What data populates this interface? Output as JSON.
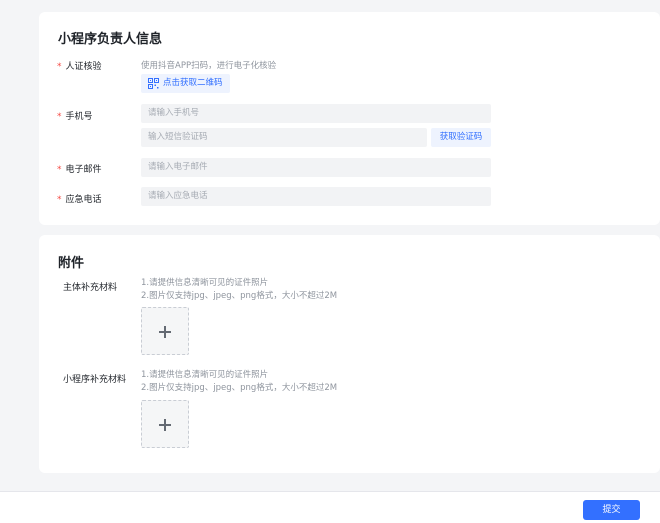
{
  "responsible_section": {
    "title": "小程序负责人信息",
    "id_verify": {
      "label": "人证核验",
      "hint": "使用抖音APP扫码，进行电子化核验",
      "qr_button": "点击获取二维码"
    },
    "phone": {
      "label": "手机号",
      "phone_placeholder": "请输入手机号",
      "sms_placeholder": "输入短信验证码",
      "get_code_button": "获取验证码"
    },
    "email": {
      "label": "电子邮件",
      "placeholder": "请输入电子邮件"
    },
    "emergency": {
      "label": "应急电话",
      "placeholder": "请输入应急电话"
    }
  },
  "attachment_section": {
    "title": "附件",
    "subject_material": {
      "label": "主体补充材料",
      "hint_line1": "1.请提供信息清晰可见的证件照片",
      "hint_line2": "2.图片仅支持jpg、jpeg、png格式，大小不超过2M"
    },
    "app_material": {
      "label": "小程序补充材料",
      "hint_line1": "1.请提供信息清晰可见的证件照片",
      "hint_line2": "2.图片仅支持jpg、jpeg、png格式，大小不超过2M"
    }
  },
  "footer": {
    "submit_label": "提交"
  },
  "required_mark": "*",
  "colors": {
    "primary": "#3370ff",
    "required": "#f54a45",
    "background": "#f4f5f7"
  }
}
